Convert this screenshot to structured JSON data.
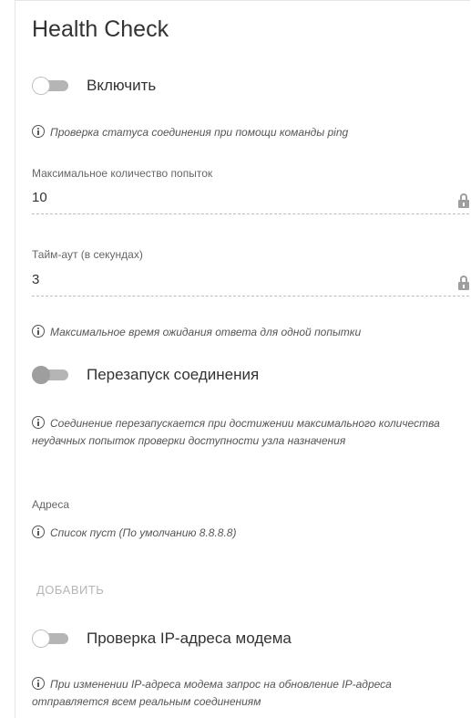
{
  "title": "Health Check",
  "enable": {
    "label": "Включить",
    "state": "off"
  },
  "hint_ping": "Проверка статуса соединения при помощи команды ping",
  "max_attempts": {
    "label": "Максимальное количество попыток",
    "value": "10"
  },
  "timeout": {
    "label": "Тайм-аут (в секундах)",
    "value": "3"
  },
  "hint_timeout": "Максимальное время ожидания ответа для одной попытки",
  "restart": {
    "label": "Перезапуск соединения",
    "state": "off"
  },
  "hint_restart": "Соединение перезапускается при достижении максимального количества неудачных попыток проверки доступности узла назначения",
  "addresses": {
    "label": "Адреса",
    "hint": "Список пуст (По умолчанию 8.8.8.8)"
  },
  "add_button": "ДОБАВИТЬ",
  "modem_check": {
    "label": "Проверка IP-адреса модема",
    "state": "off"
  },
  "hint_modem": "При изменении IP-адреса модема запрос на обновление IP-адреса отправляется всем реальным соединениям",
  "icons": {
    "info": "info-icon",
    "lock": "lock-icon"
  },
  "colors": {
    "toggle_track": "#b5b5b5",
    "muted_button": "#b5b5b5",
    "text": "#333333"
  }
}
